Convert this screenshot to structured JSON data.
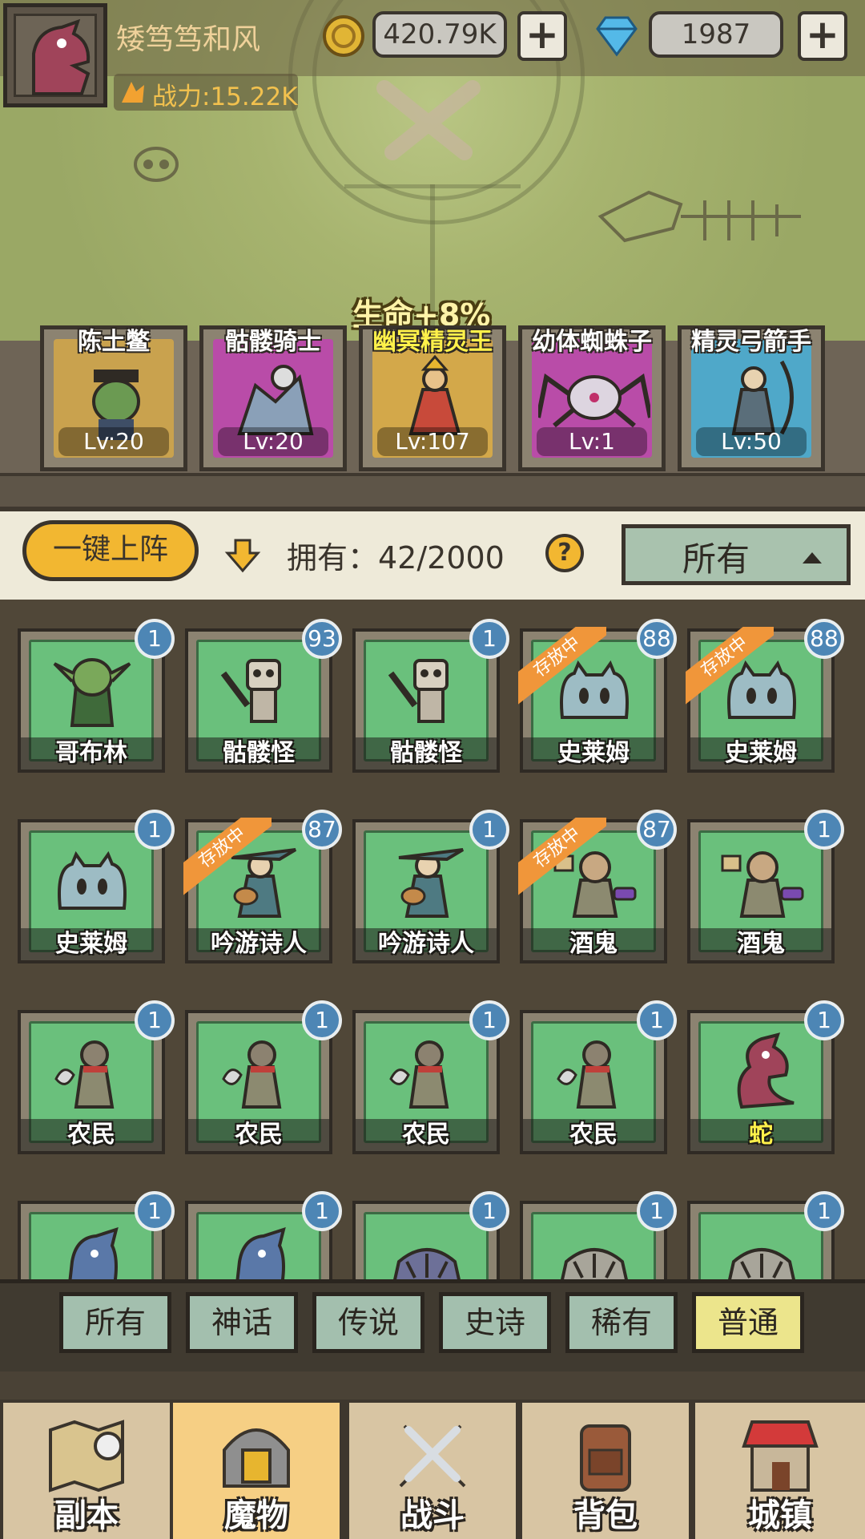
{
  "header": {
    "player_name": "矮笃笃和风",
    "power": "战力:15.22K",
    "gold": "420.79K",
    "diamonds": "1987",
    "plus": "+"
  },
  "lineup": {
    "bonus": "生命+8%",
    "slots": [
      {
        "name": "陈土鳖",
        "level": "Lv:20",
        "color": "#c9a24e"
      },
      {
        "name": "骷髅骑士",
        "level": "Lv:20",
        "color": "#b94ca8"
      },
      {
        "name": "幽冥精灵王",
        "level": "Lv:107",
        "color": "#d3a84a"
      },
      {
        "name": "幼体蜘蛛子",
        "level": "Lv:1",
        "color": "#b94ca8"
      },
      {
        "name": "精灵弓箭手",
        "level": "Lv:50",
        "color": "#4fa8c9"
      }
    ]
  },
  "controls": {
    "deploy_label": "一键上阵",
    "owned": "拥有：42/2000",
    "help": "?",
    "filter": "所有"
  },
  "monsters": [
    {
      "name": "哥布林",
      "count": "1",
      "stored": false,
      "icon": "goblin-icon",
      "highlight": false
    },
    {
      "name": "骷髅怪",
      "count": "93",
      "stored": false,
      "icon": "skeleton-icon",
      "highlight": false
    },
    {
      "name": "骷髅怪",
      "count": "1",
      "stored": false,
      "icon": "skeleton-icon",
      "highlight": false
    },
    {
      "name": "史莱姆",
      "count": "88",
      "stored": true,
      "icon": "slime-icon",
      "highlight": false
    },
    {
      "name": "史莱姆",
      "count": "88",
      "stored": true,
      "icon": "slime-icon",
      "highlight": false
    },
    {
      "name": "史莱姆",
      "count": "1",
      "stored": false,
      "icon": "slime-icon",
      "highlight": false
    },
    {
      "name": "吟游诗人",
      "count": "87",
      "stored": true,
      "icon": "bard-icon",
      "highlight": false
    },
    {
      "name": "吟游诗人",
      "count": "1",
      "stored": false,
      "icon": "bard-icon",
      "highlight": false
    },
    {
      "name": "酒鬼",
      "count": "87",
      "stored": true,
      "icon": "drunkard-icon",
      "highlight": false
    },
    {
      "name": "酒鬼",
      "count": "1",
      "stored": false,
      "icon": "drunkard-icon",
      "highlight": false
    },
    {
      "name": "农民",
      "count": "1",
      "stored": false,
      "icon": "farmer-icon",
      "highlight": false
    },
    {
      "name": "农民",
      "count": "1",
      "stored": false,
      "icon": "farmer-icon",
      "highlight": false
    },
    {
      "name": "农民",
      "count": "1",
      "stored": false,
      "icon": "farmer-icon",
      "highlight": false
    },
    {
      "name": "农民",
      "count": "1",
      "stored": false,
      "icon": "farmer-icon",
      "highlight": false
    },
    {
      "name": "蛇",
      "count": "1",
      "stored": false,
      "icon": "snake-icon",
      "highlight": true
    },
    {
      "name": "",
      "count": "1",
      "stored": false,
      "icon": "lizard-icon",
      "highlight": false
    },
    {
      "name": "",
      "count": "1",
      "stored": false,
      "icon": "lizard-icon",
      "highlight": false
    },
    {
      "name": "",
      "count": "1",
      "stored": false,
      "icon": "rock-beast-icon",
      "highlight": false
    },
    {
      "name": "",
      "count": "1",
      "stored": false,
      "icon": "rock-beast-icon",
      "highlight": false
    },
    {
      "name": "",
      "count": "1",
      "stored": false,
      "icon": "rock-beast-icon",
      "highlight": false
    }
  ],
  "stored_label": "存放中",
  "rarity_tabs": [
    {
      "label": "所有",
      "active": false
    },
    {
      "label": "神话",
      "active": false
    },
    {
      "label": "传说",
      "active": false
    },
    {
      "label": "史诗",
      "active": false
    },
    {
      "label": "稀有",
      "active": false
    },
    {
      "label": "普通",
      "active": true
    }
  ],
  "nav": [
    {
      "label": "副本",
      "icon": "map-icon",
      "active": false
    },
    {
      "label": "魔物",
      "icon": "helmet-icon",
      "active": true
    },
    {
      "label": "战斗",
      "icon": "crossed-swords-icon",
      "active": false
    },
    {
      "label": "背包",
      "icon": "backpack-icon",
      "active": false
    },
    {
      "label": "城镇",
      "icon": "shop-icon",
      "active": false
    }
  ],
  "colors": {
    "card_green": "#6ac07c",
    "count_badge": "#4d86b5",
    "stored_ribbon": "#f0963a",
    "accent_yellow": "#f2b731"
  }
}
